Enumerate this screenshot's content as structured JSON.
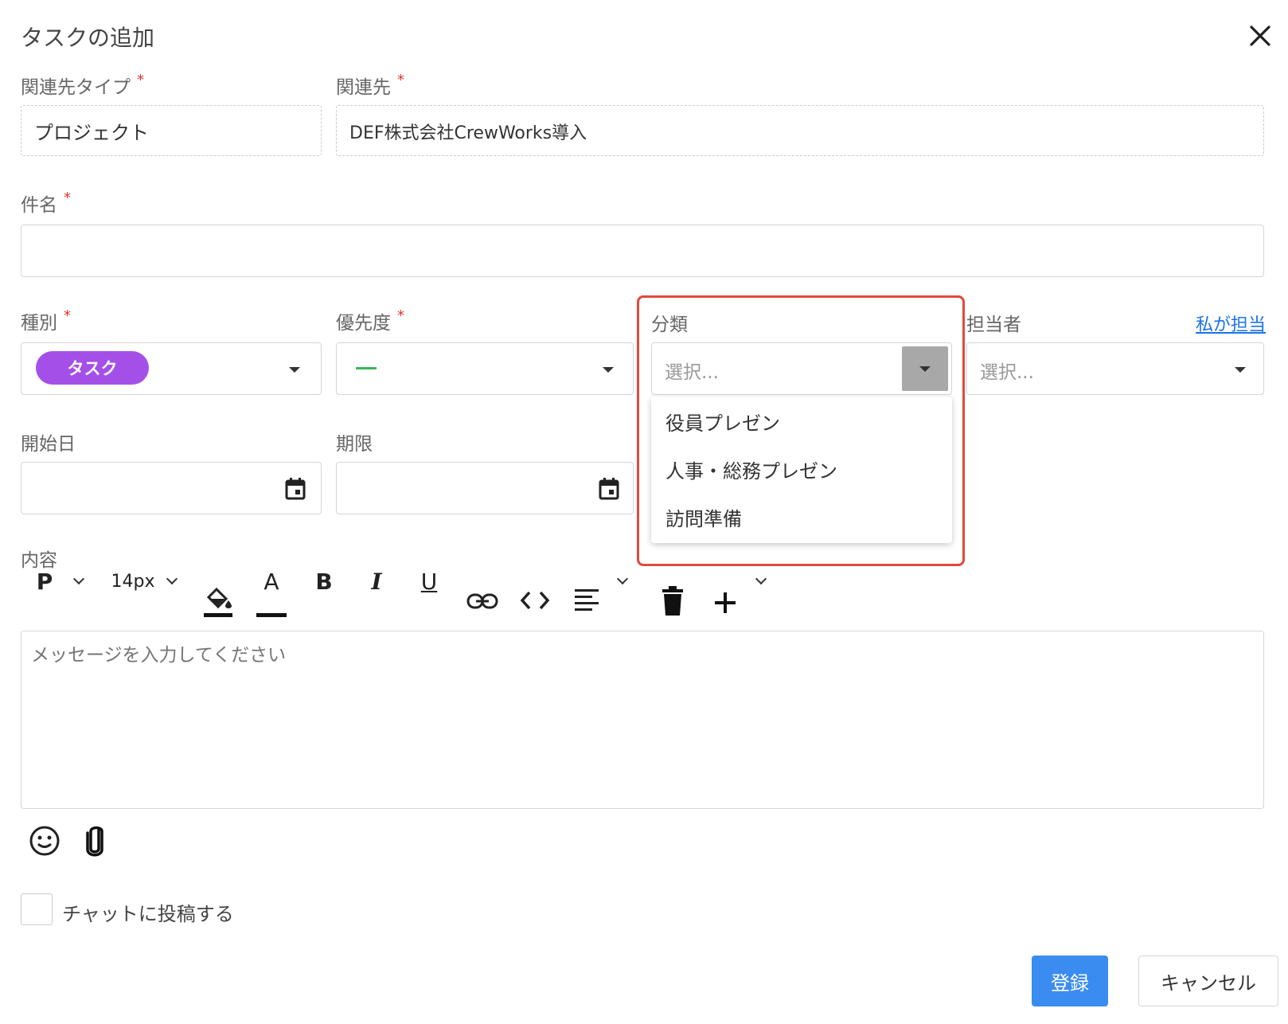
{
  "dialog": {
    "title": "タスクの追加",
    "close_icon": "close-icon"
  },
  "fields": {
    "related_type": {
      "label": "関連先タイプ",
      "required_mark": "*",
      "value": "プロジェクト"
    },
    "related_to": {
      "label": "関連先",
      "required_mark": "*",
      "value": "DEF株式会社CrewWorks導入"
    },
    "subject": {
      "label": "件名",
      "required_mark": "*",
      "value": ""
    },
    "kind": {
      "label": "種別",
      "required_mark": "*",
      "value": "タスク",
      "value_color": "#a450e8"
    },
    "priority": {
      "label": "優先度",
      "required_mark": "*",
      "value": "—",
      "value_color": "#3cb55c"
    },
    "category": {
      "label": "分類",
      "placeholder": "選択...",
      "options": [
        "役員プレゼン",
        "人事・総務プレゼン",
        "訪問準備"
      ]
    },
    "assignee": {
      "label": "担当者",
      "placeholder": "選択...",
      "assign_me_link": "私が担当"
    },
    "start_date": {
      "label": "開始日",
      "value": ""
    },
    "due_date": {
      "label": "期限",
      "value": ""
    },
    "content": {
      "label": "内容",
      "placeholder": "メッセージを入力してください"
    }
  },
  "toolbar": {
    "paragraph": "P",
    "font_size": "14px",
    "fill_icon": "paint-bucket-icon",
    "text_color_label": "A",
    "bold_label": "B",
    "italic_label": "I",
    "underline_label": "U",
    "link_icon": "link-icon",
    "code_icon": "code-icon",
    "align_icon": "align-left-icon",
    "delete_icon": "trash-icon",
    "add_icon": "plus-icon"
  },
  "attachments": {
    "emoji_icon": "smiley-icon",
    "attach_icon": "paperclip-icon"
  },
  "post_to_chat": {
    "label": "チャットに投稿する",
    "checked": false
  },
  "buttons": {
    "submit": "登録",
    "cancel": "キャンセル"
  },
  "colors": {
    "primary": "#3b8cf0",
    "highlight_border": "#e24a3b",
    "required": "#e0342b",
    "link": "#1a73e8"
  }
}
